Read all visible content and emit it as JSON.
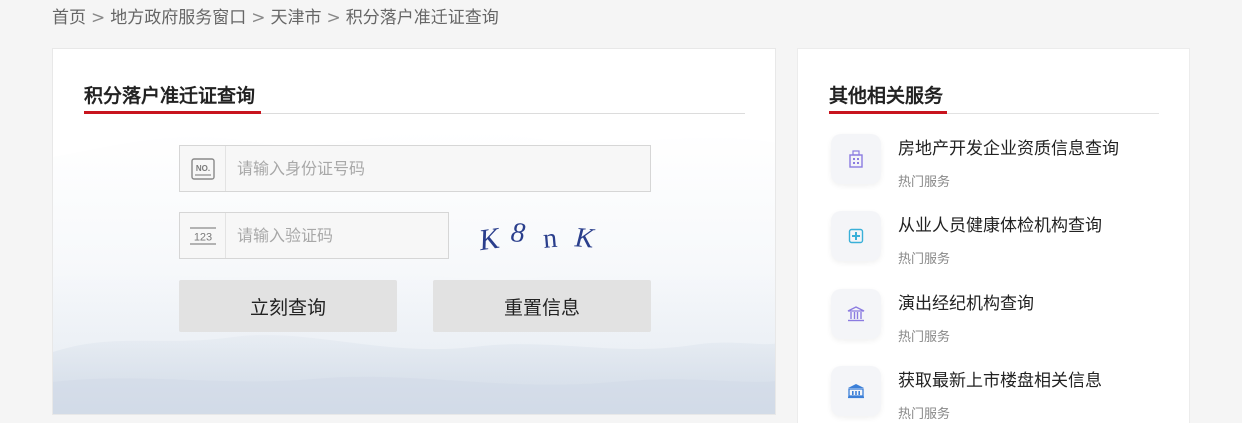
{
  "breadcrumb": {
    "items": [
      "首页",
      "地方政府服务窗口",
      "天津市",
      "积分落户准迁证查询"
    ],
    "separator": ">"
  },
  "main": {
    "title": "积分落户准迁证查询",
    "id_field": {
      "icon": "id-card-icon",
      "icon_text": "NO.",
      "placeholder": "请输入身份证号码",
      "value": ""
    },
    "code_field": {
      "icon": "number-icon",
      "icon_text": "123",
      "placeholder": "请输入验证码",
      "value": ""
    },
    "captcha": {
      "text": "K8nK",
      "chars": [
        "K",
        "8",
        "n",
        "K"
      ],
      "color": "#2a3e8c"
    },
    "query_button": "立刻查询",
    "reset_button": "重置信息"
  },
  "side": {
    "title": "其他相关服务",
    "items": [
      {
        "name": "房地产开发企业资质信息查询",
        "tag": "热门服务",
        "icon": "building-icon",
        "icon_color": "#8b7be0"
      },
      {
        "name": "从业人员健康体检机构查询",
        "tag": "热门服务",
        "icon": "medical-icon",
        "icon_color": "#3ab0d8"
      },
      {
        "name": "演出经纪机构查询",
        "tag": "热门服务",
        "icon": "institution-icon",
        "icon_color": "#8b7be0"
      },
      {
        "name": "获取最新上市楼盘相关信息",
        "tag": "热门服务",
        "icon": "bank-icon",
        "icon_color": "#3b7fd8"
      }
    ]
  },
  "colors": {
    "accent": "#c8141e",
    "background": "#f5f5f5",
    "button": "#e2e2e2"
  }
}
